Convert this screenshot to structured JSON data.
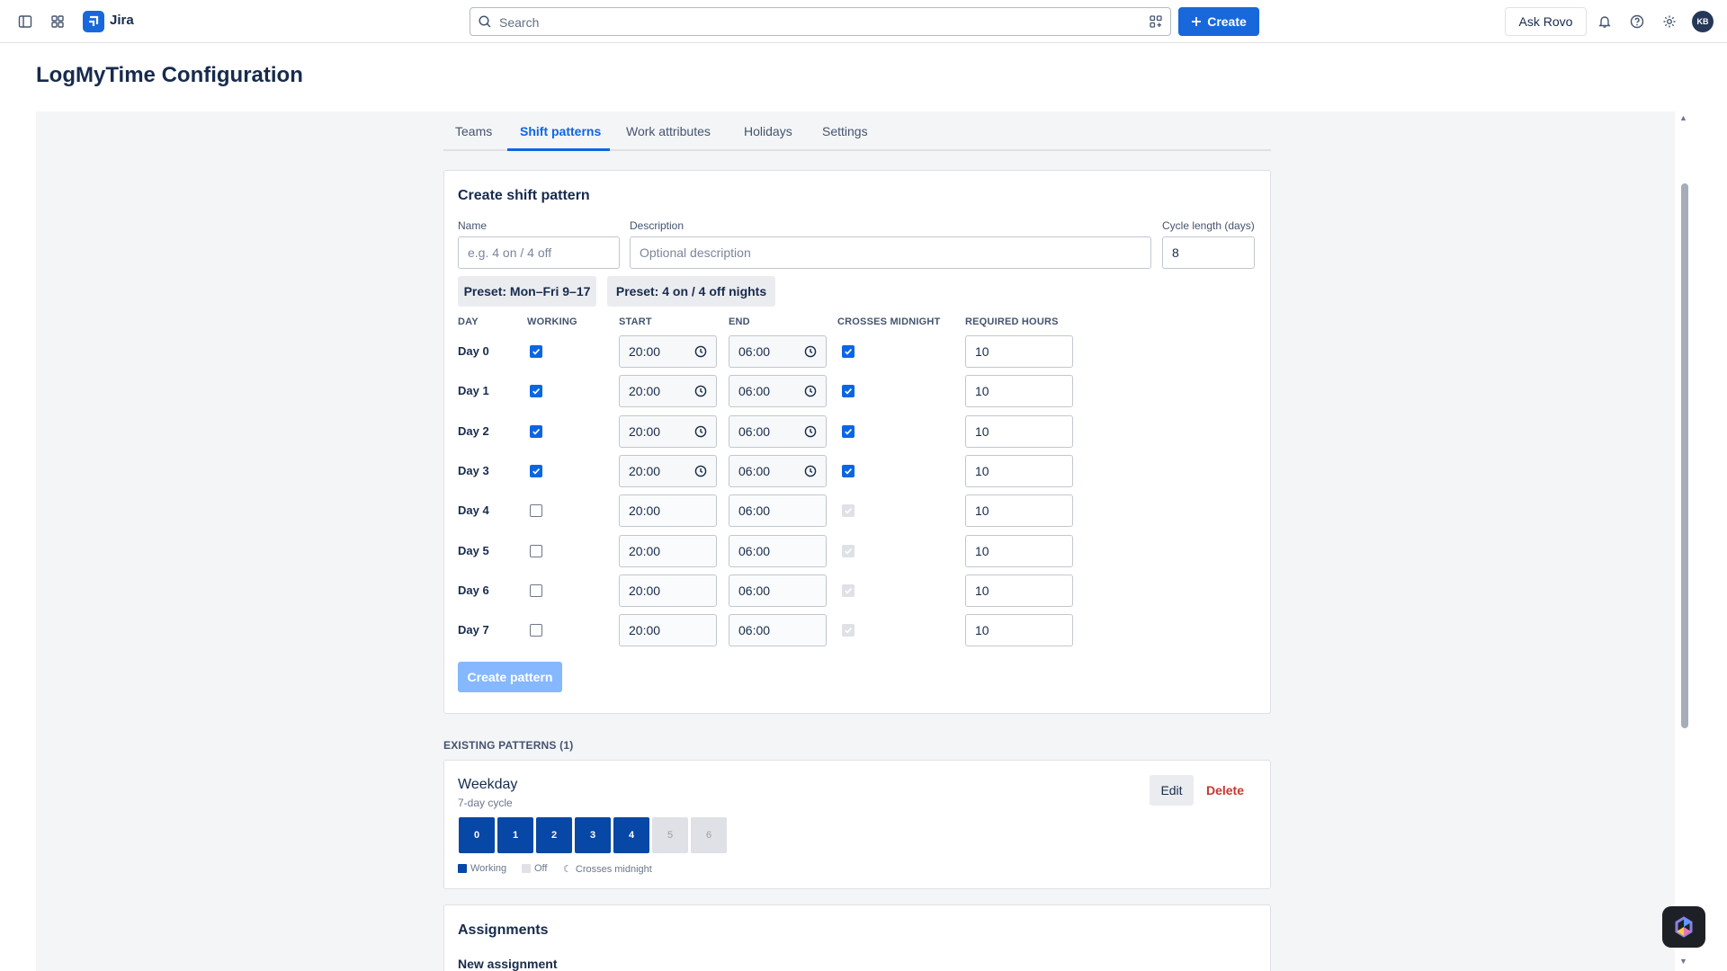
{
  "topbar": {
    "app_name": "Jira",
    "search_placeholder": "Search",
    "create_label": "Create",
    "ask_rovo_label": "Ask Rovo",
    "avatar_initials": "KB",
    "accent": "#1868db"
  },
  "page": {
    "title": "LogMyTime Configuration"
  },
  "tabs": [
    {
      "label": "Teams",
      "active": false
    },
    {
      "label": "Shift patterns",
      "active": true
    },
    {
      "label": "Work attributes",
      "active": false
    },
    {
      "label": "Holidays",
      "active": false
    },
    {
      "label": "Settings",
      "active": false
    }
  ],
  "create_form": {
    "title": "Create shift pattern",
    "name_label": "Name",
    "name_placeholder": "e.g. 4 on / 4 off",
    "description_label": "Description",
    "description_placeholder": "Optional description",
    "cycle_label": "Cycle length (days)",
    "cycle_value": "8",
    "preset_1": "Preset: Mon–Fri 9–17",
    "preset_2": "Preset: 4 on / 4 off nights",
    "columns": {
      "day": "DAY",
      "working": "WORKING",
      "start": "START",
      "end": "END",
      "crosses_midnight": "CROSSES MIDNIGHT",
      "required_hours": "REQUIRED HOURS"
    },
    "rows": [
      {
        "day": "Day 0",
        "working": true,
        "start": "20:00",
        "end": "06:00",
        "crosses_midnight": true,
        "hours": "10"
      },
      {
        "day": "Day 1",
        "working": true,
        "start": "20:00",
        "end": "06:00",
        "crosses_midnight": true,
        "hours": "10"
      },
      {
        "day": "Day 2",
        "working": true,
        "start": "20:00",
        "end": "06:00",
        "crosses_midnight": true,
        "hours": "10"
      },
      {
        "day": "Day 3",
        "working": true,
        "start": "20:00",
        "end": "06:00",
        "crosses_midnight": true,
        "hours": "10"
      },
      {
        "day": "Day 4",
        "working": false,
        "start": "20:00",
        "end": "06:00",
        "crosses_midnight": true,
        "hours": "10"
      },
      {
        "day": "Day 5",
        "working": false,
        "start": "20:00",
        "end": "06:00",
        "crosses_midnight": true,
        "hours": "10"
      },
      {
        "day": "Day 6",
        "working": false,
        "start": "20:00",
        "end": "06:00",
        "crosses_midnight": true,
        "hours": "10"
      },
      {
        "day": "Day 7",
        "working": false,
        "start": "20:00",
        "end": "06:00",
        "crosses_midnight": true,
        "hours": "10"
      }
    ],
    "submit_label": "Create pattern"
  },
  "existing": {
    "heading": "EXISTING PATTERNS (1)",
    "patterns": [
      {
        "name": "Weekday",
        "subtitle": "7-day cycle",
        "edit_label": "Edit",
        "delete_label": "Delete",
        "days": [
          {
            "label": "0",
            "working": true
          },
          {
            "label": "1",
            "working": true
          },
          {
            "label": "2",
            "working": true
          },
          {
            "label": "3",
            "working": true
          },
          {
            "label": "4",
            "working": true
          },
          {
            "label": "5",
            "working": false
          },
          {
            "label": "6",
            "working": false
          }
        ],
        "legend": {
          "working": "Working",
          "off": "Off",
          "crosses": "Crosses midnight",
          "crosses_glyph": "☾"
        }
      }
    ]
  },
  "assignments": {
    "title": "Assignments",
    "subtitle": "New assignment"
  }
}
